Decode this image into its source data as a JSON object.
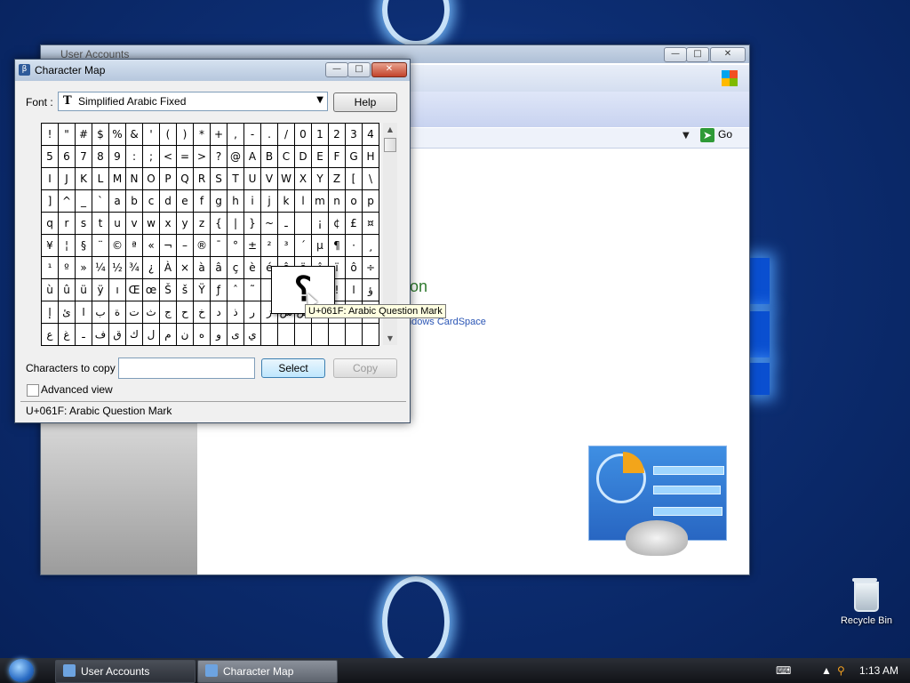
{
  "desktop": {
    "recycle_bin_label": "Recycle Bin"
  },
  "user_accounts_window": {
    "title": "User Accounts",
    "go_label": "Go",
    "partial_heading": "on",
    "partial_link": "ndows CardSpace"
  },
  "charmap": {
    "title": "Character Map",
    "font_label": "Font :",
    "font_value": "Simplified Arabic Fixed",
    "help_label": "Help",
    "characters_to_copy_label": "Characters to copy :",
    "characters_to_copy_value": "",
    "select_label": "Select",
    "copy_label": "Copy",
    "advanced_view_label": "Advanced view",
    "advanced_view_checked": false,
    "status_text": "U+061F: Arabic Question Mark",
    "tooltip_text": "U+061F: Arabic Question Mark",
    "magnified_char": "؟",
    "grid": [
      [
        "!",
        "\"",
        "#",
        "$",
        "%",
        "&",
        "'",
        "(",
        ")",
        "*",
        "+",
        ",",
        "-",
        ".",
        "/",
        "0",
        "1",
        "2",
        "3",
        "4"
      ],
      [
        "5",
        "6",
        "7",
        "8",
        "9",
        ":",
        ";",
        "<",
        "=",
        ">",
        "?",
        "@",
        "A",
        "B",
        "C",
        "D",
        "E",
        "F",
        "G",
        "H"
      ],
      [
        "I",
        "J",
        "K",
        "L",
        "M",
        "N",
        "O",
        "P",
        "Q",
        "R",
        "S",
        "T",
        "U",
        "V",
        "W",
        "X",
        "Y",
        "Z",
        "[",
        "\\"
      ],
      [
        "]",
        "^",
        "_",
        "`",
        "a",
        "b",
        "c",
        "d",
        "e",
        "f",
        "g",
        "h",
        "i",
        "j",
        "k",
        "l",
        "m",
        "n",
        "o",
        "p"
      ],
      [
        "q",
        "r",
        "s",
        "t",
        "u",
        "v",
        "w",
        "x",
        "y",
        "z",
        "{",
        "|",
        "}",
        "~",
        "ـ",
        "",
        "¡",
        "¢",
        "£",
        "¤"
      ],
      [
        "¥",
        "¦",
        "§",
        "¨",
        "©",
        "ª",
        "«",
        "¬",
        "–",
        "®",
        "¯",
        "°",
        "±",
        "²",
        "³",
        "´",
        "µ",
        "¶",
        "·",
        "¸"
      ],
      [
        "¹",
        "º",
        "»",
        "¼",
        "½",
        "¾",
        "¿",
        "À",
        "×",
        "à",
        "â",
        "ç",
        "è",
        "é",
        "ê",
        "ë",
        "î",
        "ï",
        "ô",
        "÷"
      ],
      [
        "ù",
        "û",
        "ü",
        "ÿ",
        "ı",
        "Œ",
        "œ",
        "Š",
        "š",
        "Ÿ",
        "ƒ",
        "ˆ",
        "˜",
        "",
        "",
        "",
        "",
        "!",
        "ا",
        "ؤ"
      ],
      [
        "إ",
        "ئ",
        "ا",
        "ب",
        "ة",
        "ت",
        "ث",
        "ج",
        "ح",
        "خ",
        "د",
        "ذ",
        "ر",
        "ز",
        "س",
        "ش",
        "ص",
        "ض",
        "ط",
        "ظ"
      ],
      [
        "ع",
        "غ",
        "ـ",
        "ف",
        "ق",
        "ك",
        "ل",
        "م",
        "ن",
        "ه",
        "و",
        "ى",
        "ي",
        "",
        "",
        "",
        "",
        "",
        "",
        ""
      ]
    ]
  },
  "taskbar": {
    "buttons": [
      {
        "label": "User Accounts",
        "active": false
      },
      {
        "label": "Character Map",
        "active": true
      }
    ],
    "clock": "1:13 AM"
  }
}
